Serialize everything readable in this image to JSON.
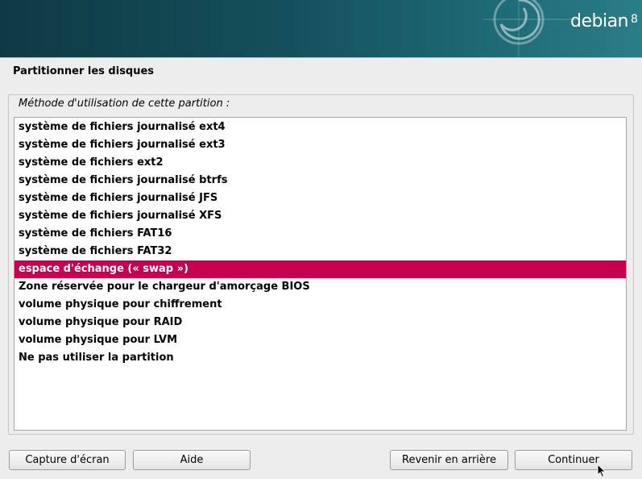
{
  "banner": {
    "brand": "debian",
    "version": "8"
  },
  "page": {
    "title": "Partitionner les disques"
  },
  "method": {
    "label": "Méthode d'utilisation de cette partition :",
    "selected_index": 8,
    "options": [
      "système de fichiers journalisé ext4",
      "système de fichiers journalisé ext3",
      "système de fichiers ext2",
      "système de fichiers journalisé btrfs",
      "système de fichiers journalisé JFS",
      "système de fichiers journalisé XFS",
      "système de fichiers FAT16",
      "système de fichiers FAT32",
      "espace d'échange (« swap »)",
      "Zone réservée pour le chargeur d'amorçage BIOS",
      "volume physique pour chiffrement",
      "volume physique pour RAID",
      "volume physique pour LVM",
      "Ne pas utiliser la partition"
    ]
  },
  "buttons": {
    "screenshot": "Capture d'écran",
    "help": "Aide",
    "back": "Revenir en arrière",
    "continue": "Continuer"
  },
  "colors": {
    "selection": "#c6004f",
    "banner": "#14505b"
  }
}
